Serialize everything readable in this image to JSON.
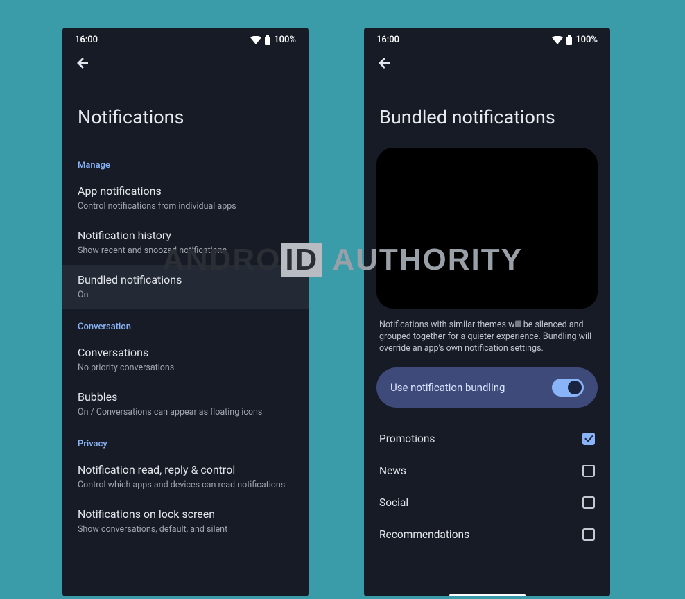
{
  "status": {
    "time": "16:00",
    "battery": "100%"
  },
  "screen1": {
    "title": "Notifications",
    "sections": [
      {
        "header": "Manage",
        "items": [
          {
            "title": "App notifications",
            "sub": "Control notifications from individual apps",
            "hl": false
          },
          {
            "title": "Notification history",
            "sub": "Show recent and snoozed notifications",
            "hl": false
          },
          {
            "title": "Bundled notifications",
            "sub": "On",
            "hl": true
          }
        ]
      },
      {
        "header": "Conversation",
        "items": [
          {
            "title": "Conversations",
            "sub": "No priority conversations",
            "hl": false
          },
          {
            "title": "Bubbles",
            "sub": "On / Conversations can appear as floating icons",
            "hl": false
          }
        ]
      },
      {
        "header": "Privacy",
        "items": [
          {
            "title": "Notification read, reply & control",
            "sub": "Control which apps and devices can read notifications",
            "hl": false
          },
          {
            "title": "Notifications on lock screen",
            "sub": "Show conversations, default, and silent",
            "hl": false
          }
        ]
      }
    ]
  },
  "screen2": {
    "title": "Bundled notifications",
    "description": "Notifications with similar themes will be silenced and grouped together for a quieter experience. Bundling will override an app's own notification settings.",
    "toggle_label": "Use notification bundling",
    "toggle_on": true,
    "categories": [
      {
        "label": "Promotions",
        "checked": true
      },
      {
        "label": "News",
        "checked": false
      },
      {
        "label": "Social",
        "checked": false
      },
      {
        "label": "Recommendations",
        "checked": false
      }
    ]
  },
  "watermark": {
    "part1": "ANDRO",
    "part2": "ID",
    "part3": "AUTHORITY"
  }
}
